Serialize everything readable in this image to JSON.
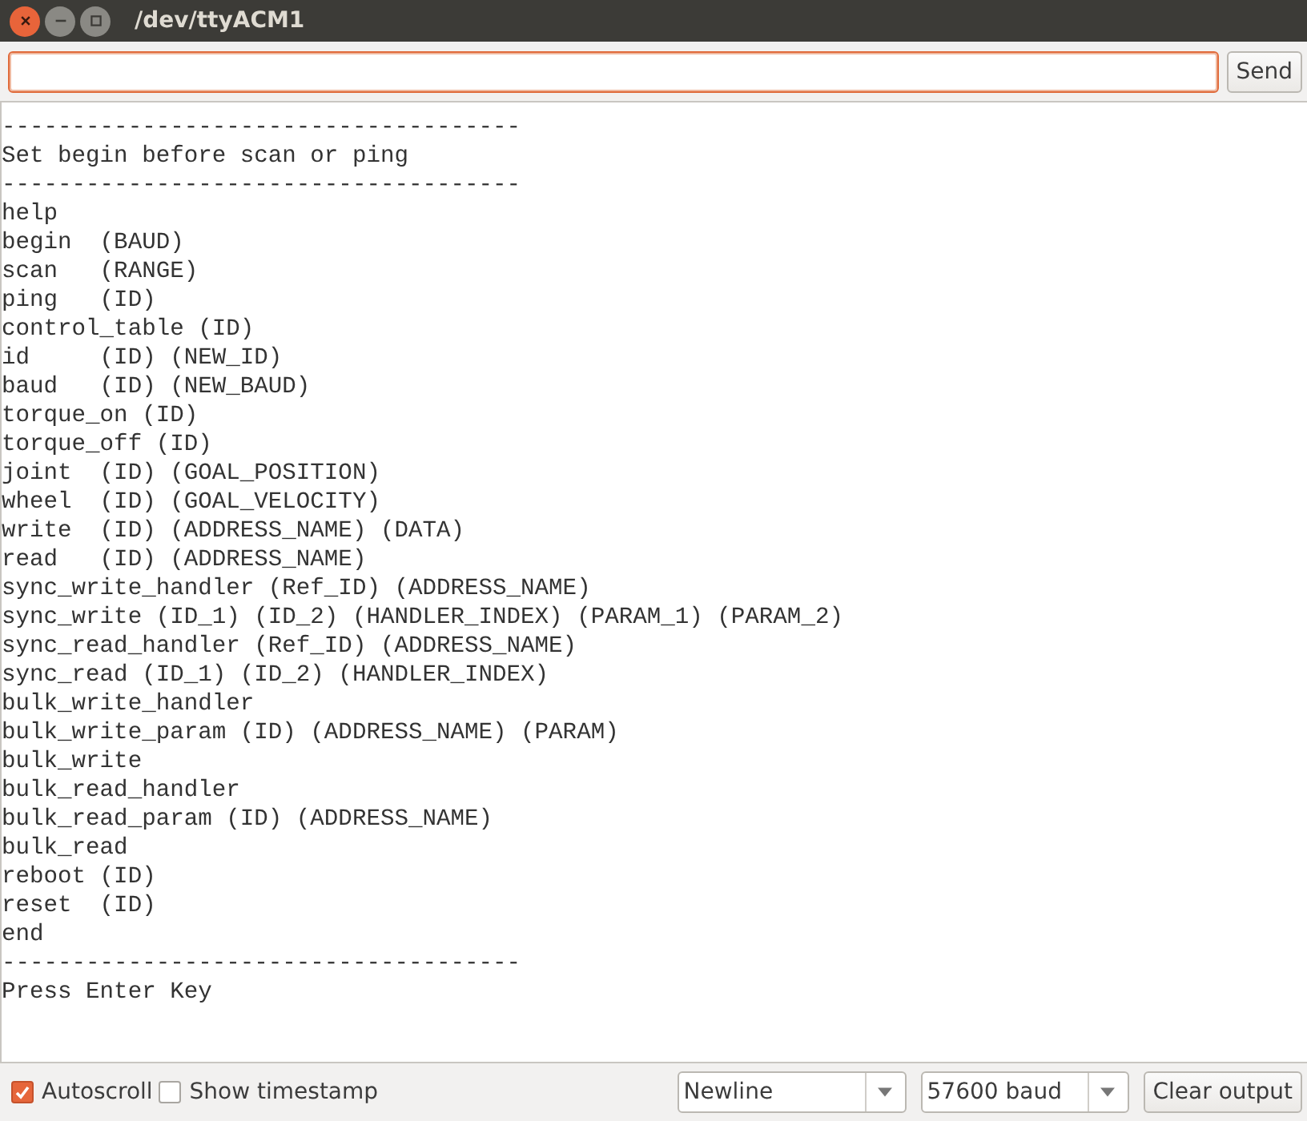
{
  "window": {
    "title": "/dev/ttyACM1"
  },
  "input": {
    "focused": true
  },
  "send_button": "Send",
  "output_lines": [
    "-------------------------------------",
    "Set begin before scan or ping",
    "-------------------------------------",
    "help",
    "begin  (BAUD)",
    "scan   (RANGE)",
    "ping   (ID)",
    "control_table (ID)",
    "id     (ID) (NEW_ID)",
    "baud   (ID) (NEW_BAUD)",
    "torque_on (ID)",
    "torque_off (ID)",
    "joint  (ID) (GOAL_POSITION)",
    "wheel  (ID) (GOAL_VELOCITY)",
    "write  (ID) (ADDRESS_NAME) (DATA)",
    "read   (ID) (ADDRESS_NAME)",
    "sync_write_handler (Ref_ID) (ADDRESS_NAME)",
    "sync_write (ID_1) (ID_2) (HANDLER_INDEX) (PARAM_1) (PARAM_2)",
    "sync_read_handler (Ref_ID) (ADDRESS_NAME)",
    "sync_read (ID_1) (ID_2) (HANDLER_INDEX)",
    "bulk_write_handler",
    "bulk_write_param (ID) (ADDRESS_NAME) (PARAM)",
    "bulk_write",
    "bulk_read_handler",
    "bulk_read_param (ID) (ADDRESS_NAME)",
    "bulk_read",
    "reboot (ID)",
    "reset  (ID)",
    "end",
    "-------------------------------------",
    "Press Enter Key"
  ],
  "options": [
    {
      "label": "Autoscroll",
      "checked": true
    },
    {
      "label": "Show timestamp",
      "checked": false
    }
  ],
  "line_ending": "Newline",
  "baud_rate": "57600 baud",
  "clear_button": "Clear output"
}
